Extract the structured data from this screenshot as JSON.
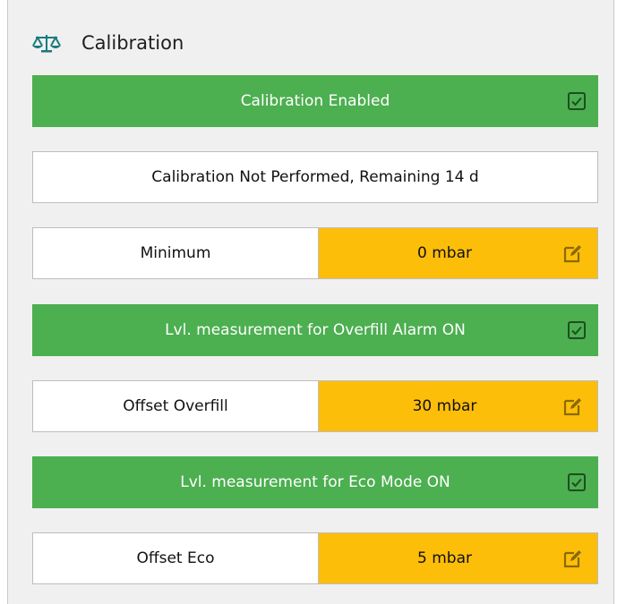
{
  "header": {
    "title": "Calibration",
    "icon": "balance-scale-icon"
  },
  "calibration_enabled": {
    "label": "Calibration Enabled",
    "checked": true
  },
  "status": {
    "text": "Calibration Not Performed, Remaining 14 d"
  },
  "minimum": {
    "label": "Minimum",
    "value": "0 mbar"
  },
  "overfill_alarm": {
    "label": "Lvl. measurement for Overfill Alarm ON",
    "checked": true
  },
  "offset_overfill": {
    "label": "Offset Overfill",
    "value": "30 mbar"
  },
  "eco_mode": {
    "label": "Lvl. measurement for Eco Mode ON",
    "checked": true
  },
  "offset_eco": {
    "label": "Offset Eco",
    "value": "5 mbar"
  },
  "colors": {
    "toggle_green": "#4caf50",
    "value_amber": "#fdbe0a",
    "panel_bg": "#f0f0f0",
    "icon_teal": "#1a7b7b"
  }
}
